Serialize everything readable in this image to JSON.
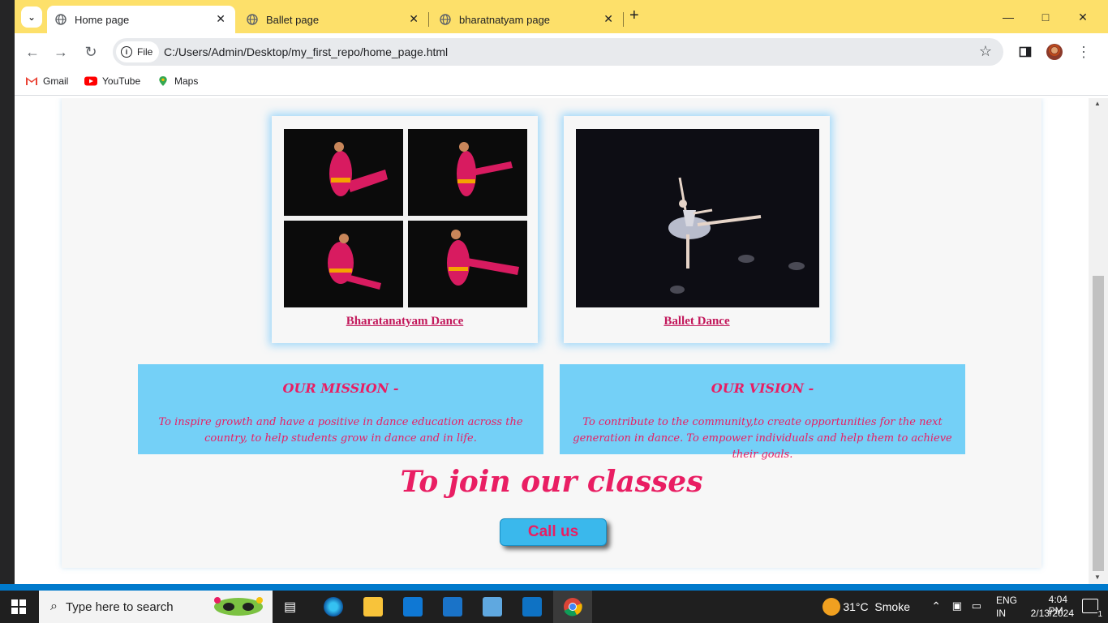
{
  "tabs": [
    {
      "title": "Home page",
      "active": true
    },
    {
      "title": "Ballet page",
      "active": false
    },
    {
      "title": "bharatnatyam page",
      "active": false
    }
  ],
  "address": {
    "scheme_label": "File",
    "url": "C:/Users/Admin/Desktop/my_first_repo/home_page.html"
  },
  "bookmarks": [
    {
      "label": "Gmail",
      "icon": "gmail-icon"
    },
    {
      "label": "YouTube",
      "icon": "youtube-icon"
    },
    {
      "label": "Maps",
      "icon": "maps-icon"
    }
  ],
  "cards": [
    {
      "link": "Bharatanatyam Dance"
    },
    {
      "link": "Ballet Dance"
    }
  ],
  "mission": {
    "title": "OUR MISSION -",
    "text": "To inspire growth and have a positive in dance education across the country, to help students grow in dance and in life."
  },
  "vision": {
    "title": "OUR VISION -",
    "text": "To contribute to the community,to create opportunities for the next generation in dance. To empower individuals and help them to achieve their goals."
  },
  "join_heading": "To join our classes",
  "call_button": "Call us",
  "taskbar": {
    "search_placeholder": "Type here to search",
    "weather": "31°C  Smoke",
    "lang": "ENG",
    "region": "IN",
    "time": "4:04 PM",
    "date": "2/13/2024",
    "notifications": "1"
  },
  "colors": {
    "tabbar": "#fde06a",
    "accent_pink": "#e91e63",
    "info_blue": "#74d0f7",
    "button_blue": "#3ab8ec"
  }
}
